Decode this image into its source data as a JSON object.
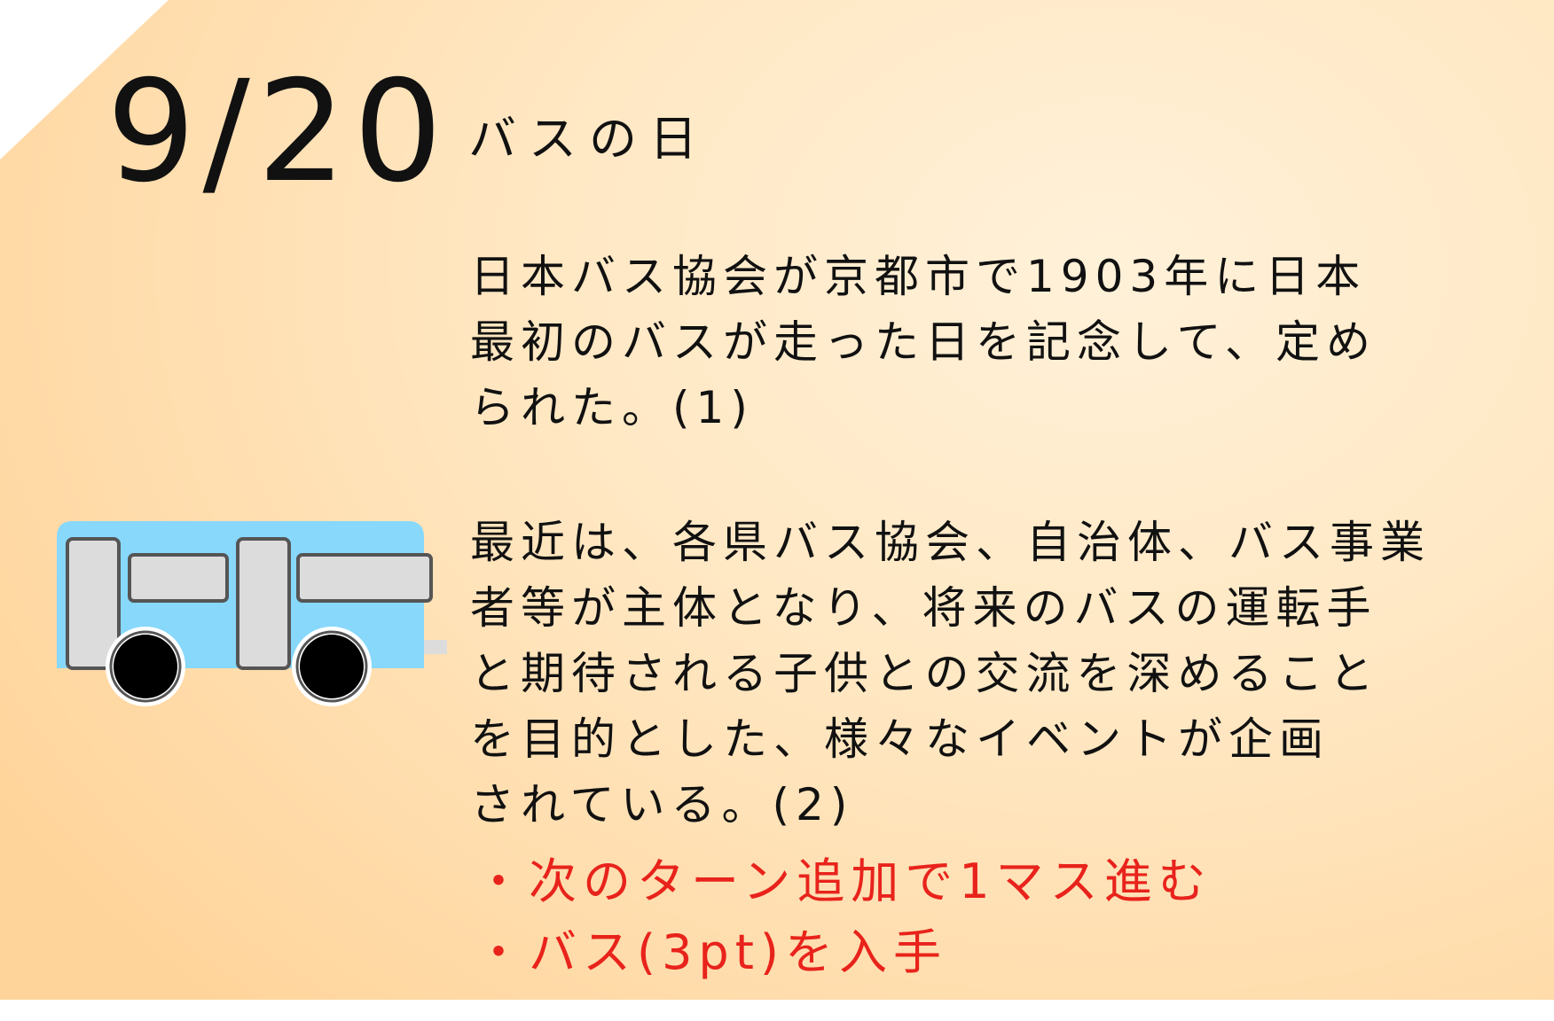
{
  "card": {
    "date": "9/20",
    "title": "バスの日",
    "paragraph1": [
      "日本バス協会が京都市で1903年に日本",
      "最初のバスが走った日を記念して、定め",
      "られた。(1)"
    ],
    "paragraph2": [
      "最近は、各県バス協会、自治体、バス事業",
      "者等が主体となり、将来のバスの運転手",
      "と期待される子供との交流を深めること",
      "を目的とした、様々なイベントが企画",
      "されている。(2)"
    ],
    "effects": [
      "・次のターン追加で1マス進む",
      "・バス(3pt)を入手"
    ],
    "illustration": "bus-icon",
    "colors": {
      "effect_text": "#e8231b",
      "bus_body": "#87d8fb",
      "background_light": "#fff1d9",
      "background_dark": "#ffd49a"
    }
  }
}
